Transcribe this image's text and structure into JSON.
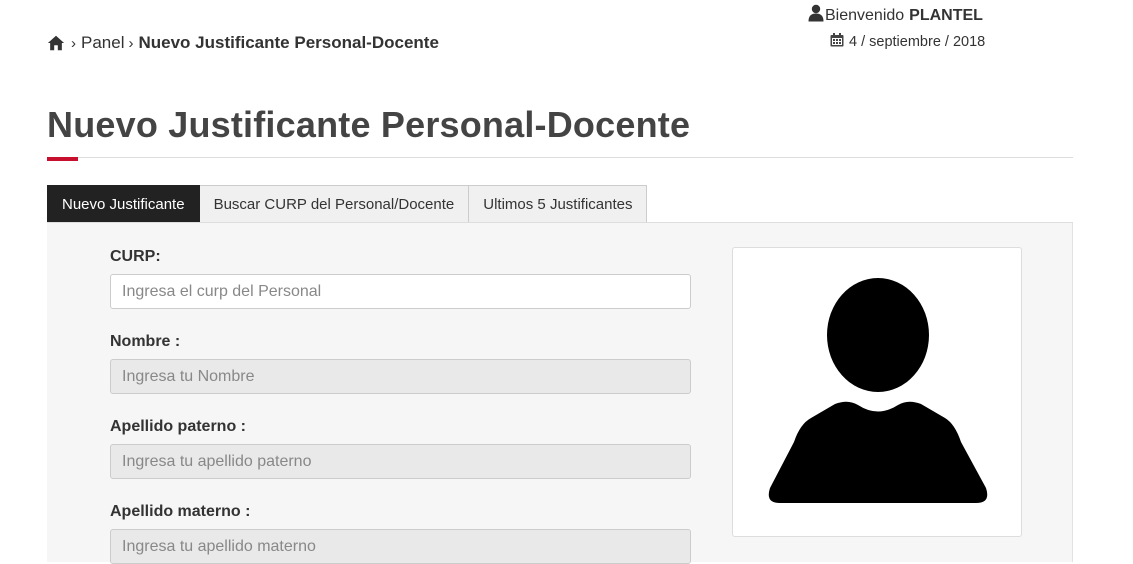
{
  "breadcrumb": {
    "home_icon": "home-icon",
    "separator": "›",
    "panel_label": "Panel",
    "current_label": "Nuevo Justificante Personal-Docente"
  },
  "header": {
    "user_icon": "user-icon",
    "welcome_text": "Bienvenido",
    "user_name": "PLANTEL",
    "calendar_icon": "calendar-icon",
    "date": "4 / septiembre / 2018"
  },
  "page": {
    "title": "Nuevo Justificante Personal-Docente",
    "accent_color": "#c8102e"
  },
  "tabs": [
    {
      "label": "Nuevo Justificante",
      "active": true
    },
    {
      "label": "Buscar CURP del Personal/Docente",
      "active": false
    },
    {
      "label": "Ultimos 5 Justificantes",
      "active": false
    }
  ],
  "form": {
    "curp": {
      "label": "CURP:",
      "placeholder": "Ingresa el curp del Personal",
      "value": ""
    },
    "nombre": {
      "label": "Nombre :",
      "placeholder": "Ingresa tu Nombre",
      "value": ""
    },
    "apellido_paterno": {
      "label": "Apellido paterno :",
      "placeholder": "Ingresa tu apellido paterno",
      "value": ""
    },
    "apellido_materno": {
      "label": "Apellido materno :",
      "placeholder": "Ingresa tu apellido materno",
      "value": ""
    }
  },
  "photo": {
    "icon": "avatar-placeholder-icon"
  }
}
